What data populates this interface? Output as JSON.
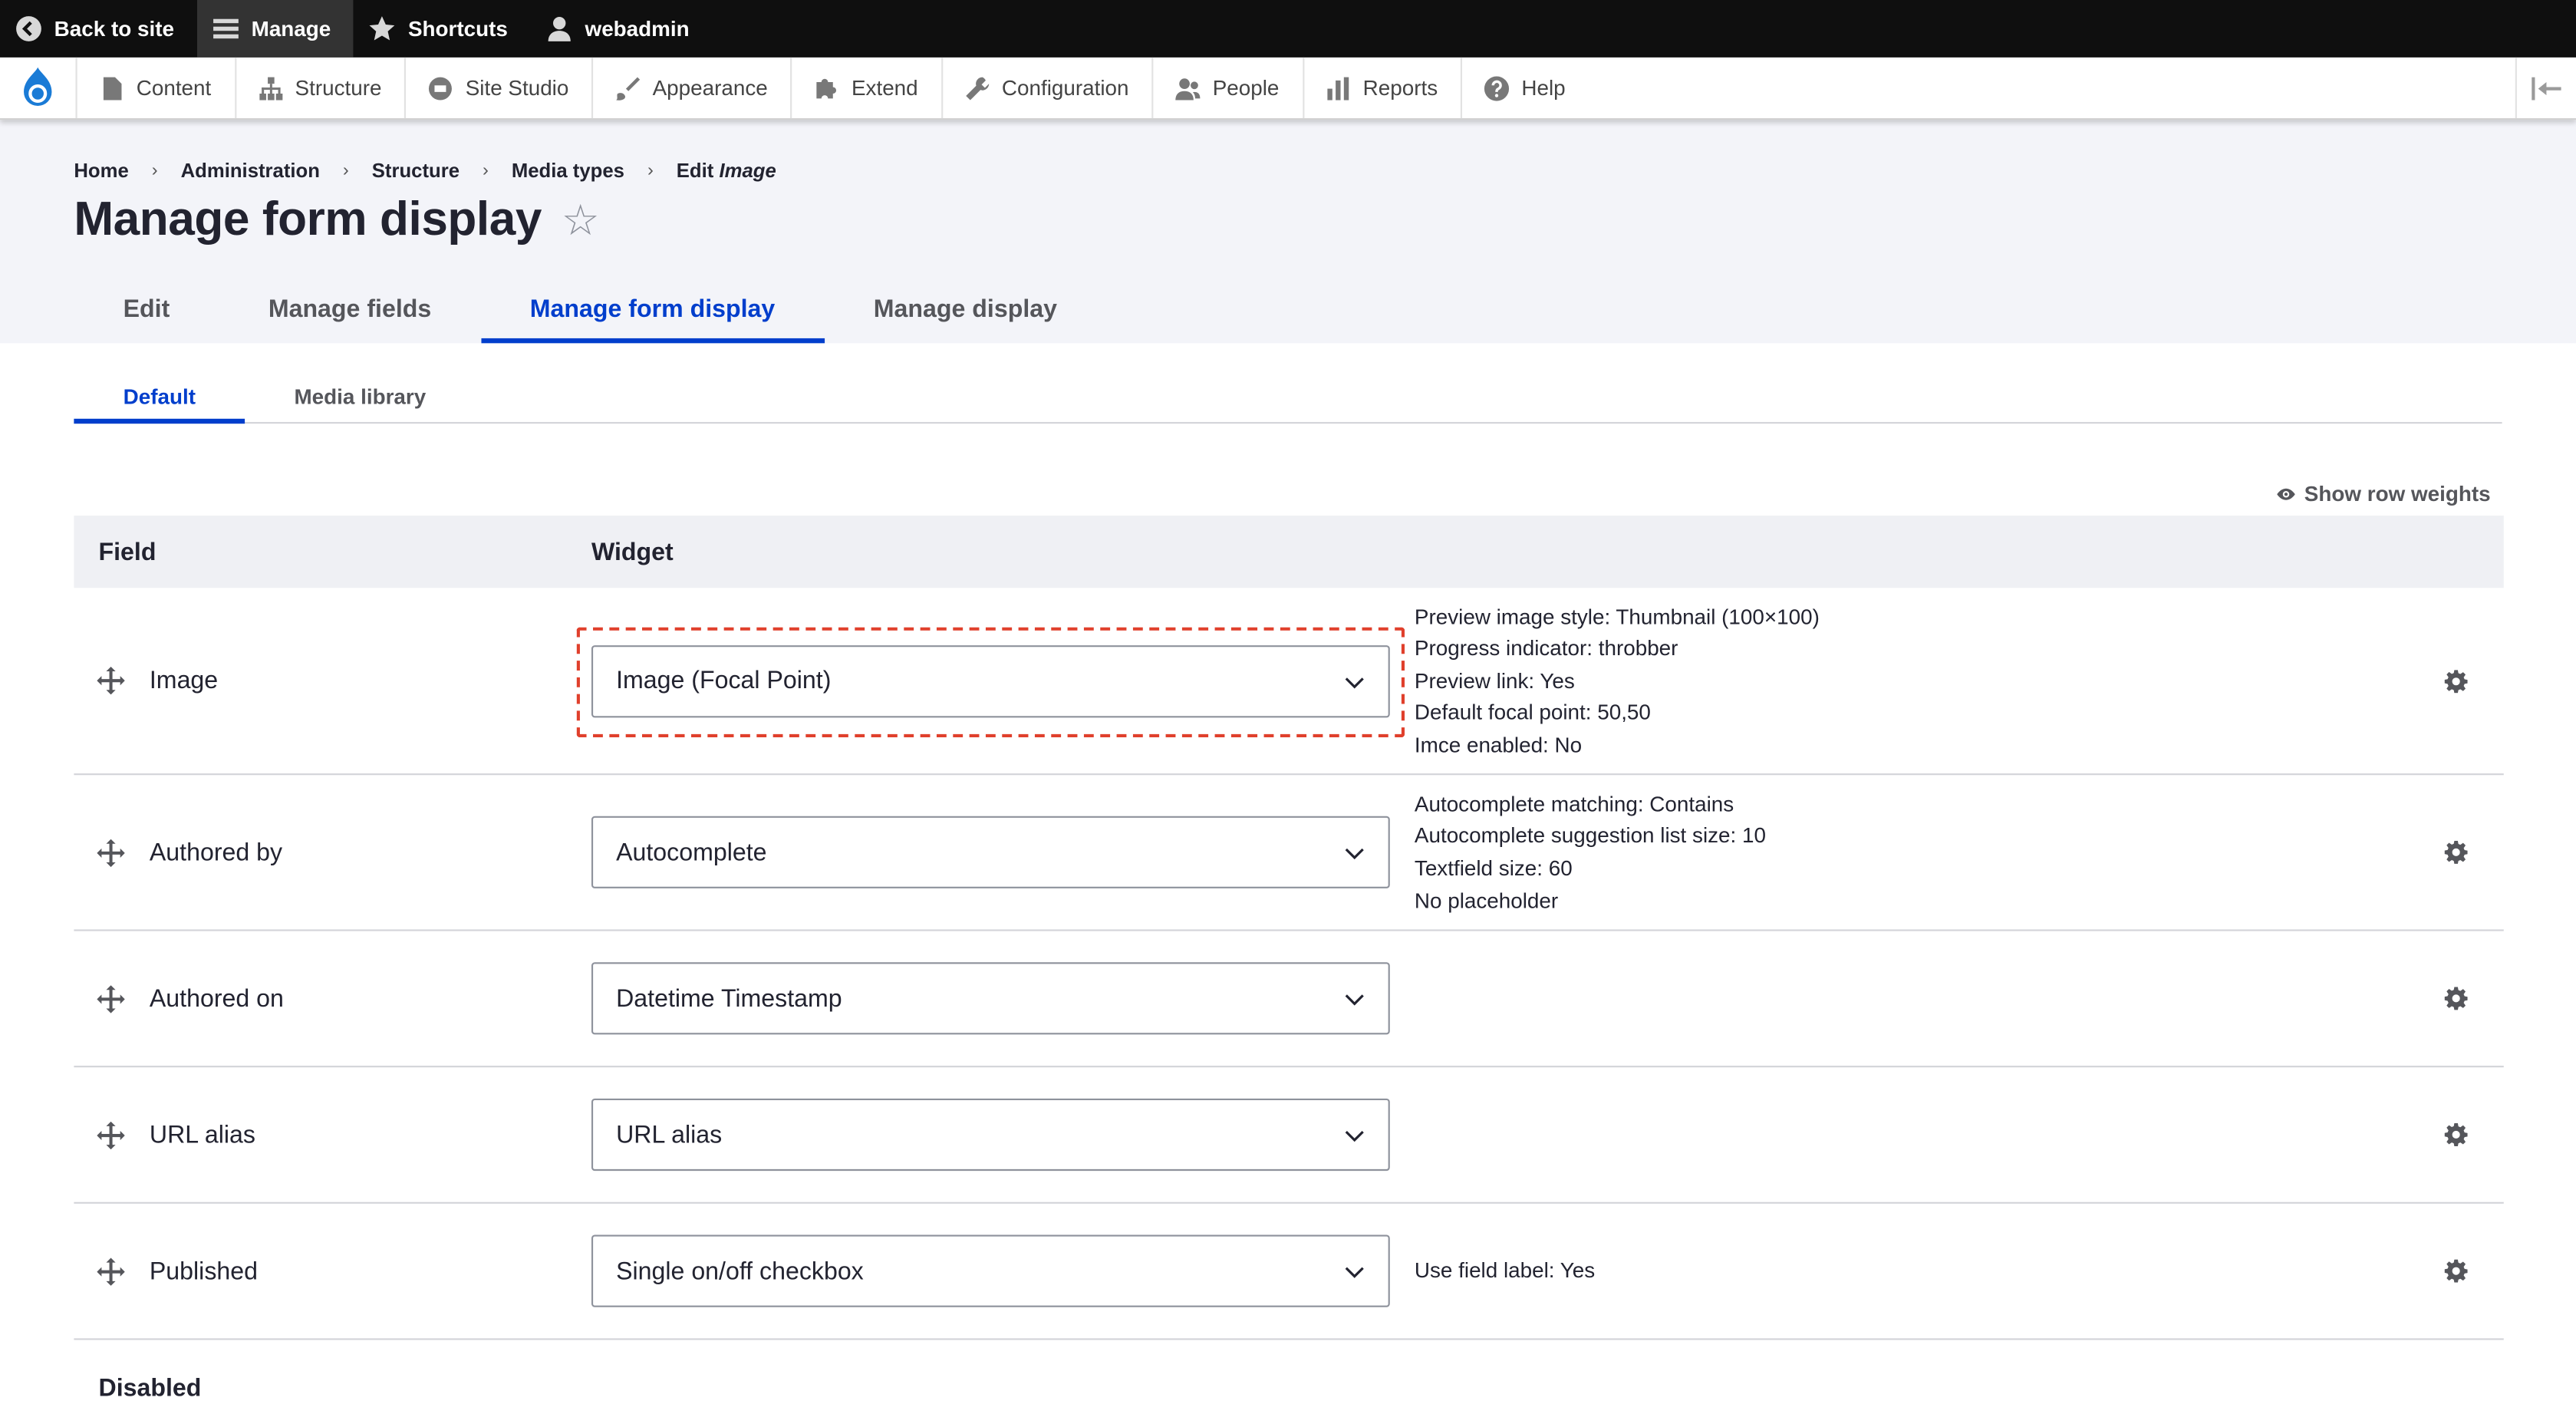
{
  "toolbar": {
    "back_to_site": "Back to site",
    "manage": "Manage",
    "shortcuts": "Shortcuts",
    "user": "webadmin"
  },
  "admin_menu": {
    "items": [
      {
        "label": "Content",
        "icon": "file-icon"
      },
      {
        "label": "Structure",
        "icon": "sitemap-icon"
      },
      {
        "label": "Site Studio",
        "icon": "site-studio-icon"
      },
      {
        "label": "Appearance",
        "icon": "brush-icon"
      },
      {
        "label": "Extend",
        "icon": "puzzle-icon"
      },
      {
        "label": "Configuration",
        "icon": "wrench-icon"
      },
      {
        "label": "People",
        "icon": "people-icon"
      },
      {
        "label": "Reports",
        "icon": "bar-chart-icon"
      },
      {
        "label": "Help",
        "icon": "help-icon"
      }
    ]
  },
  "breadcrumb": {
    "items": [
      "Home",
      "Administration",
      "Structure",
      "Media types"
    ],
    "current_prefix": "Edit",
    "current_em": "Image"
  },
  "page": {
    "title": "Manage form display",
    "star": "☆"
  },
  "tabs_primary": [
    {
      "label": "Edit",
      "active": false
    },
    {
      "label": "Manage fields",
      "active": false
    },
    {
      "label": "Manage form display",
      "active": true
    },
    {
      "label": "Manage display",
      "active": false
    }
  ],
  "tabs_secondary": [
    {
      "label": "Default",
      "active": true
    },
    {
      "label": "Media library",
      "active": false
    }
  ],
  "show_row_weights": "Show row weights",
  "table": {
    "headers": {
      "field": "Field",
      "widget": "Widget"
    },
    "rows": [
      {
        "field": "Image",
        "widget": "Image (Focal Point)",
        "summary": [
          "Preview image style: Thumbnail (100×100)",
          "Progress indicator: throbber",
          "Preview link: Yes",
          "Default focal point: 50,50",
          "Imce enabled: No"
        ]
      },
      {
        "field": "Authored by",
        "widget": "Autocomplete",
        "summary": [
          "Autocomplete matching: Contains",
          "Autocomplete suggestion list size: 10",
          "Textfield size: 60",
          "No placeholder"
        ]
      },
      {
        "field": "Authored on",
        "widget": "Datetime Timestamp",
        "summary": []
      },
      {
        "field": "URL alias",
        "widget": "URL alias",
        "summary": []
      },
      {
        "field": "Published",
        "widget": "Single on/off checkbox",
        "summary": [
          "Use field label: Yes"
        ]
      }
    ],
    "disabled_heading": "Disabled"
  },
  "colors": {
    "accent": "#003ecc",
    "toolbar_bg": "#0f0f0f",
    "header_bg": "#f3f4f9",
    "highlight": "#e0402c"
  }
}
